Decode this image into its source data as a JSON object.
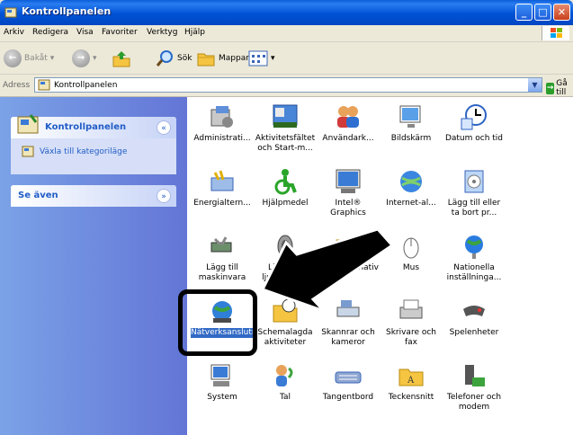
{
  "window": {
    "title": "Kontrollpanelen",
    "controls": {
      "minimize": "_",
      "maximize": "□",
      "close": "✕"
    }
  },
  "menubar": {
    "items": [
      "Arkiv",
      "Redigera",
      "Visa",
      "Favoriter",
      "Verktyg",
      "Hjälp"
    ]
  },
  "toolbar": {
    "back_label": "Bakåt",
    "search_label": "Sök",
    "folders_label": "Mappar"
  },
  "addressbar": {
    "label": "Adress",
    "value": "Kontrollpanelen",
    "go_label": "Gå till"
  },
  "sidebar": {
    "panel1": {
      "title": "Kontrollpanelen",
      "link": "Växla till kategoriläge"
    },
    "panel2": {
      "title": "Se även"
    }
  },
  "icons": [
    {
      "label": "Administrati...",
      "icon": "admin-tools-icon"
    },
    {
      "label": "Aktivitetsfältet och Start-m...",
      "icon": "taskbar-icon"
    },
    {
      "label": "Användark...",
      "icon": "user-accounts-icon"
    },
    {
      "label": "Bildskärm",
      "icon": "display-icon"
    },
    {
      "label": "Datum och tid",
      "icon": "date-time-icon"
    },
    {
      "label": "Energialtern...",
      "icon": "power-options-icon"
    },
    {
      "label": "Hjälpmedel",
      "icon": "accessibility-icon"
    },
    {
      "label": "Intel® Graphics",
      "icon": "intel-graphics-icon"
    },
    {
      "label": "Internet-al...",
      "icon": "internet-options-icon"
    },
    {
      "label": "Lägg till eller ta bort pr...",
      "icon": "add-remove-programs-icon"
    },
    {
      "label": "Lägg till maskinvara",
      "icon": "add-hardware-icon"
    },
    {
      "label": "Ljud och ljudenheter",
      "icon": "sounds-icon"
    },
    {
      "label": "Mappalternativ",
      "icon": "folder-options-icon"
    },
    {
      "label": "Mus",
      "icon": "mouse-icon"
    },
    {
      "label": "Nationella inställninga...",
      "icon": "regional-settings-icon"
    },
    {
      "label": "Nätverksanslutningar",
      "icon": "network-connections-icon",
      "selected": true
    },
    {
      "label": "Schemalagda aktiviteter",
      "icon": "scheduled-tasks-icon"
    },
    {
      "label": "Skannrar och kameror",
      "icon": "scanners-icon"
    },
    {
      "label": "Skrivare och fax",
      "icon": "printers-icon"
    },
    {
      "label": "Spelenheter",
      "icon": "game-controllers-icon"
    },
    {
      "label": "System",
      "icon": "system-icon"
    },
    {
      "label": "Tal",
      "icon": "speech-icon"
    },
    {
      "label": "Tangentbord",
      "icon": "keyboard-icon"
    },
    {
      "label": "Teckensnitt",
      "icon": "fonts-icon"
    },
    {
      "label": "Telefoner och modem",
      "icon": "phone-modem-icon"
    }
  ],
  "colors": {
    "titlebar": "#0053d6",
    "sidebar": "#6375d6",
    "selection": "#316ac5",
    "annotation": "#000000"
  }
}
